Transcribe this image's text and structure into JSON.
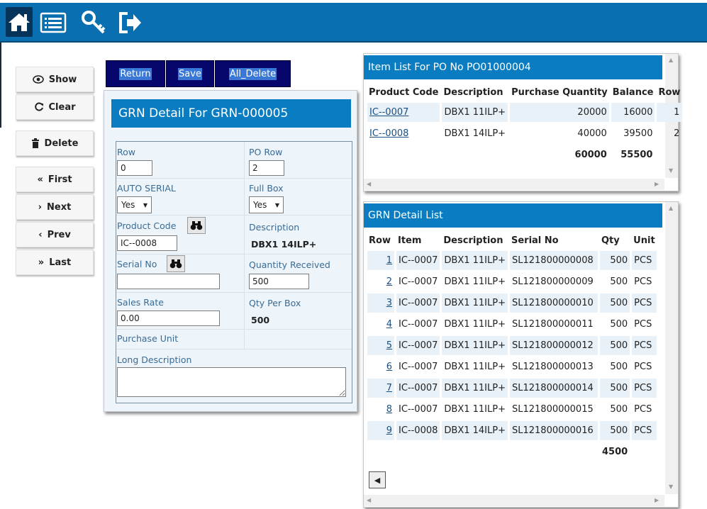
{
  "toolbar": {
    "icons": [
      "home-icon",
      "list-icon",
      "key-icon",
      "logout-icon"
    ]
  },
  "sidebar": {
    "show": "Show",
    "clear": "Clear",
    "delete": "Delete",
    "first": "First",
    "next": "Next",
    "prev": "Prev",
    "last": "Last"
  },
  "actions": {
    "return": "Return",
    "save": "Save",
    "all_delete": "All_Delete"
  },
  "grn_form": {
    "title": "GRN Detail For GRN-000005",
    "row_label": "Row",
    "row_value": "0",
    "po_row_label": "PO Row",
    "po_row_value": "2",
    "auto_serial_label": "AUTO SERIAL",
    "auto_serial_value": "Yes",
    "full_box_label": "Full Box",
    "full_box_value": "Yes",
    "product_code_label": "Product Code",
    "product_code_value": "IC--0008",
    "description_label": "Description",
    "description_value": "DBX1 14ILP+",
    "serial_no_label": "Serial No",
    "serial_no_value": "",
    "quantity_received_label": "Quantity Received",
    "quantity_received_value": "500",
    "sales_rate_label": "Sales Rate",
    "sales_rate_value": "0.00",
    "qty_per_box_label": "Qty Per Box",
    "qty_per_box_value": "500",
    "purchase_unit_label": "Purchase Unit",
    "long_description_label": "Long Description",
    "long_description_value": ""
  },
  "item_list": {
    "title": "Item List For PO No PO01000004",
    "columns": [
      "Product Code",
      "Description",
      "Purchase Quantity",
      "Balance",
      "Row"
    ],
    "rows": [
      {
        "code": "IC--0007",
        "desc": "DBX1 11ILP+",
        "qty": "20000",
        "balance": "16000",
        "row": "1"
      },
      {
        "code": "IC--0008",
        "desc": "DBX1 14ILP+",
        "qty": "40000",
        "balance": "39500",
        "row": "2"
      }
    ],
    "total_qty": "60000",
    "total_balance": "55500"
  },
  "grn_list": {
    "title": "GRN Detail List",
    "columns": [
      "Row",
      "Item",
      "Description",
      "Serial No",
      "Qty",
      "Unit"
    ],
    "rows": [
      {
        "row": "1",
        "item": "IC--0007",
        "desc": "DBX1 11ILP+",
        "serial": "SL121800000008",
        "qty": "500",
        "unit": "PCS"
      },
      {
        "row": "2",
        "item": "IC--0007",
        "desc": "DBX1 11ILP+",
        "serial": "SL121800000009",
        "qty": "500",
        "unit": "PCS"
      },
      {
        "row": "3",
        "item": "IC--0007",
        "desc": "DBX1 11ILP+",
        "serial": "SL121800000010",
        "qty": "500",
        "unit": "PCS"
      },
      {
        "row": "4",
        "item": "IC--0007",
        "desc": "DBX1 11ILP+",
        "serial": "SL121800000011",
        "qty": "500",
        "unit": "PCS"
      },
      {
        "row": "5",
        "item": "IC--0007",
        "desc": "DBX1 11ILP+",
        "serial": "SL121800000012",
        "qty": "500",
        "unit": "PCS"
      },
      {
        "row": "6",
        "item": "IC--0007",
        "desc": "DBX1 11ILP+",
        "serial": "SL121800000013",
        "qty": "500",
        "unit": "PCS"
      },
      {
        "row": "7",
        "item": "IC--0007",
        "desc": "DBX1 11ILP+",
        "serial": "SL121800000014",
        "qty": "500",
        "unit": "PCS"
      },
      {
        "row": "8",
        "item": "IC--0007",
        "desc": "DBX1 11ILP+",
        "serial": "SL121800000015",
        "qty": "500",
        "unit": "PCS"
      },
      {
        "row": "9",
        "item": "IC--0008",
        "desc": "DBX1 14ILP+",
        "serial": "SL121800000016",
        "qty": "500",
        "unit": "PCS"
      }
    ],
    "total_qty": "4500"
  },
  "colors": {
    "topbar": "#0a6fb0",
    "header": "#0a7dc2",
    "action_button": "#07066a"
  }
}
